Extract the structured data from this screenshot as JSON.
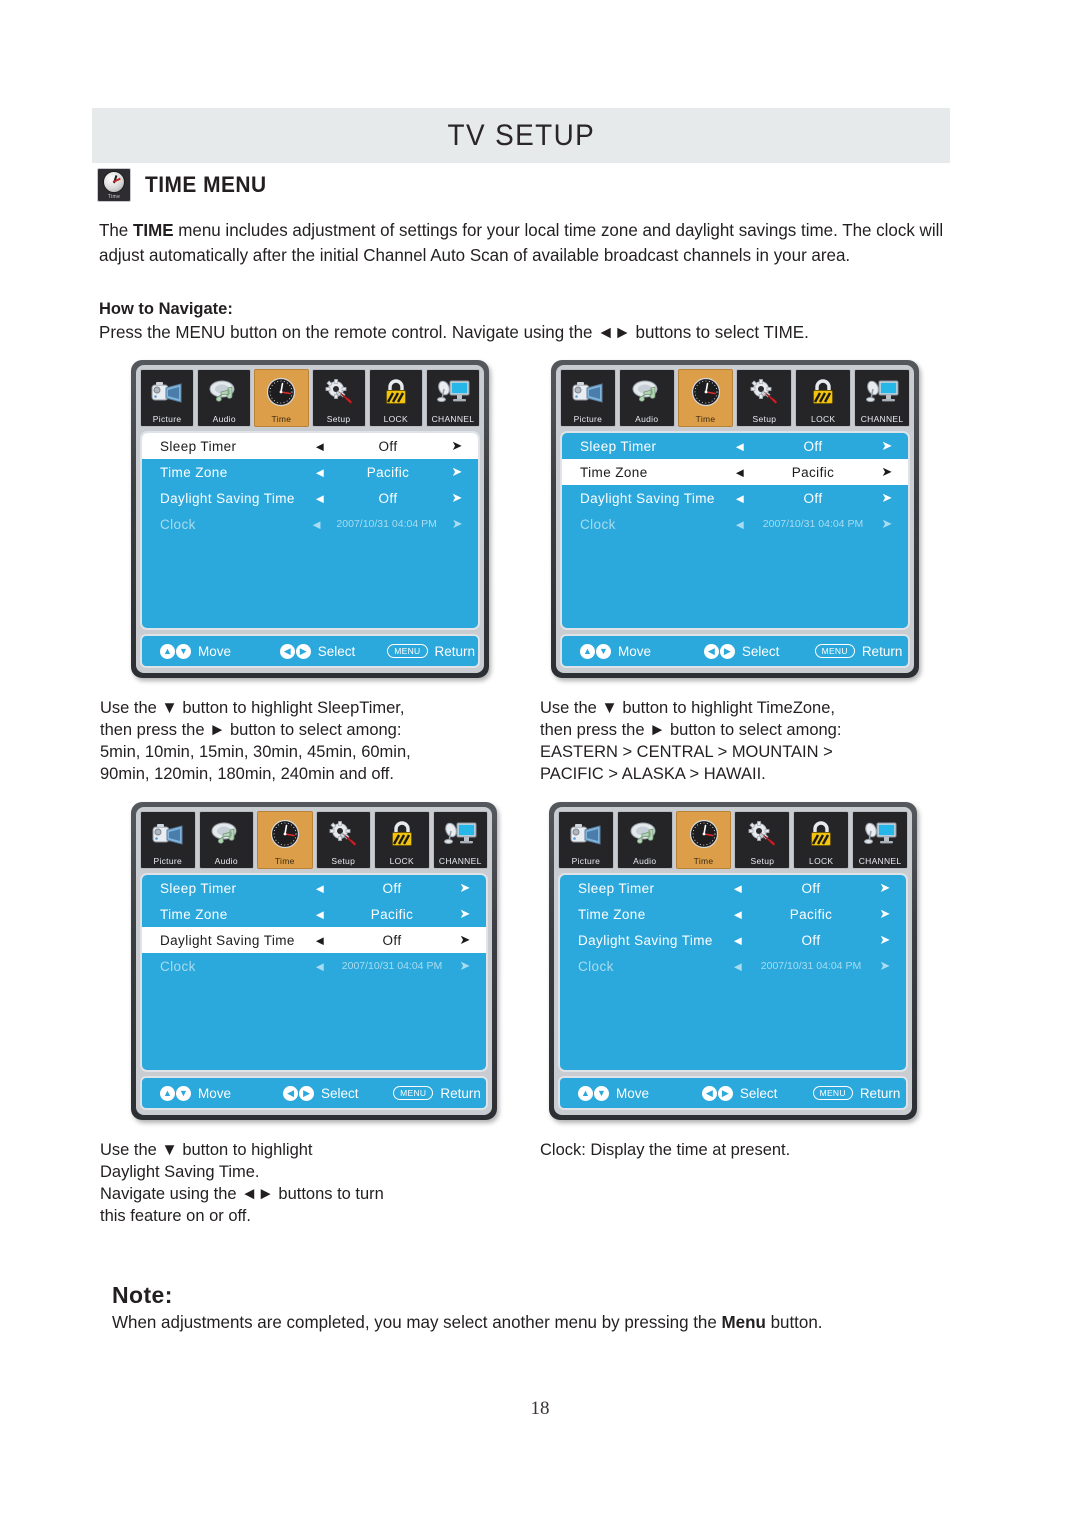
{
  "header": {
    "title": "TV SETUP"
  },
  "section": {
    "heading": "TIME MENU",
    "icon_caption": "Time"
  },
  "intro": {
    "line_prefix": "The ",
    "bold": "TIME",
    "rest": " menu includes adjustment of settings for your local time zone and daylight savings time. The clock will adjust automatically after the initial Channel Auto Scan of available broadcast channels in your area."
  },
  "howto": {
    "label": "How to Navigate:",
    "text": "Press the MENU button on the remote control. Navigate using the ◄► buttons to select TIME."
  },
  "tabs": [
    {
      "label": "Picture",
      "icon": "camcorder-icon"
    },
    {
      "label": "Audio",
      "icon": "speaker-note-icon"
    },
    {
      "label": "Time",
      "icon": "clock-icon"
    },
    {
      "label": "Setup",
      "icon": "gear-screwdriver-icon"
    },
    {
      "label": "LOCK",
      "icon": "padlock-icon"
    },
    {
      "label": "CHANNEL",
      "icon": "satellite-monitor-icon"
    }
  ],
  "rows": {
    "sleep_timer": {
      "name": "Sleep Timer",
      "value": "Off"
    },
    "time_zone": {
      "name": "Time Zone",
      "value": "Pacific"
    },
    "daylight": {
      "name": "Daylight Saving Time",
      "value": "Off"
    },
    "clock": {
      "name": "Clock",
      "value": "2007/10/31 04:04 PM"
    }
  },
  "arrows": {
    "left": "◄",
    "right": "➤"
  },
  "statusbar": {
    "move": "Move",
    "select": "Select",
    "return": "Return",
    "menu_key": "MENU",
    "up": "▲",
    "down": "▼",
    "prev": "◀",
    "next": "▶"
  },
  "menus": [
    {
      "id": "menu-1-sleep-timer-selected",
      "selected_row": "sleep_timer"
    },
    {
      "id": "menu-2-time-zone-selected",
      "selected_row": "time_zone"
    },
    {
      "id": "menu-3-daylight-selected",
      "selected_row": "daylight"
    },
    {
      "id": "menu-4-clock-view",
      "selected_row": "none"
    }
  ],
  "captions": {
    "sleep_timer": "Use the ▼ button to highlight SleepTimer,\nthen press the ► button to select among:\n5min, 10min, 15min, 30min, 45min, 60min,\n90min, 120min, 180min, 240min and off.",
    "time_zone": "Use the ▼ button to highlight TimeZone,\nthen press the ► button to select among:\nEASTERN > CENTRAL > MOUNTAIN >\nPACIFIC > ALASKA > HAWAII.",
    "daylight": "Use the ▼ button to highlight\nDaylight Saving Time.\nNavigate using the ◄► buttons to turn\nthis feature on or off.",
    "clock": "Clock: Display the time at present."
  },
  "note": {
    "heading": "Note:",
    "prefix": "When adjustments are completed, you may select another menu by pressing the ",
    "bold": "Menu",
    "suffix": " button."
  },
  "page_number": "18",
  "colors": {
    "menu_blue": "#2ba8dc",
    "tab_active": "#dc9e48",
    "header_band": "#e6eaea",
    "text": "#231f20"
  }
}
